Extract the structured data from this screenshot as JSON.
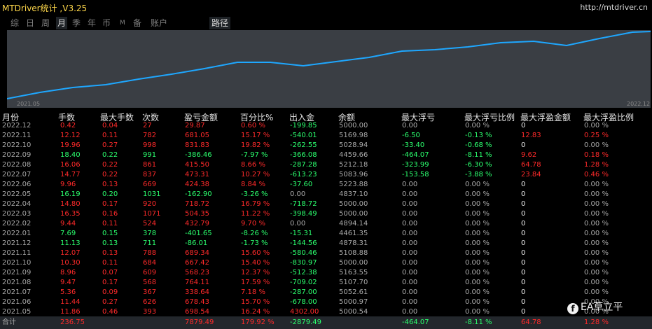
{
  "app": {
    "title": "MTDriver统计 ,V3.25",
    "url": "http://mtdriver.cn"
  },
  "tabs": [
    {
      "label": "综",
      "selected": false
    },
    {
      "label": "日",
      "selected": false
    },
    {
      "label": "周",
      "selected": false
    },
    {
      "label": "月",
      "selected": true
    },
    {
      "label": "季",
      "selected": false
    },
    {
      "label": "年",
      "selected": false
    },
    {
      "label": "币",
      "selected": false
    },
    {
      "label": "M",
      "selected": false
    },
    {
      "label": "备",
      "selected": false
    },
    {
      "label": "账户",
      "selected": false
    },
    {
      "label": "路径",
      "selected": true
    }
  ],
  "chart": {
    "start_label": "2021.05",
    "end_label": "2022.12",
    "line_color": "#1ea7ff",
    "background": "#3a3e44"
  },
  "colors": {
    "red": "#ff2a2a",
    "green": "#2bff6e",
    "white": "#e8e8e8",
    "gray": "#a8a8a8",
    "yellow": "#ffd84a"
  },
  "table": {
    "headers": [
      "月份",
      "手数",
      "最大手数",
      "次数",
      "盈亏金额",
      "百分比%",
      "出入金",
      "余额",
      "最大浮亏",
      "最大浮亏比例",
      "最大浮盈金额",
      "最大浮盈比例"
    ],
    "rows": [
      {
        "c": [
          "2022.12",
          "0.42",
          "0.04",
          "27",
          "29.87",
          "0.60 %",
          "-199.85",
          "5000.00",
          "0.00",
          "0.00 %",
          "0",
          "0.00 %"
        ],
        "t": [
          "gray",
          "red",
          "red",
          "red",
          "red",
          "red",
          "green",
          "gray",
          "gray",
          "gray",
          "white",
          "gray"
        ]
      },
      {
        "c": [
          "2022.11",
          "12.12",
          "0.11",
          "782",
          "681.05",
          "15.17 %",
          "-540.01",
          "5169.98",
          "-6.50",
          "-0.13 %",
          "12.83",
          "0.25 %"
        ],
        "t": [
          "gray",
          "red",
          "red",
          "red",
          "red",
          "red",
          "green",
          "gray",
          "green",
          "green",
          "red",
          "red"
        ]
      },
      {
        "c": [
          "2022.10",
          "19.96",
          "0.27",
          "998",
          "831.83",
          "19.82 %",
          "-262.55",
          "5028.94",
          "-33.40",
          "-0.68 %",
          "0",
          "0.00 %"
        ],
        "t": [
          "gray",
          "red",
          "red",
          "red",
          "red",
          "red",
          "green",
          "gray",
          "green",
          "green",
          "white",
          "gray"
        ]
      },
      {
        "c": [
          "2022.09",
          "18.40",
          "0.22",
          "991",
          "-386.46",
          "-7.97 %",
          "-366.08",
          "4459.66",
          "-464.07",
          "-8.11 %",
          "9.62",
          "0.18 %"
        ],
        "t": [
          "gray",
          "green",
          "green",
          "green",
          "green",
          "green",
          "green",
          "gray",
          "green",
          "green",
          "red",
          "red"
        ]
      },
      {
        "c": [
          "2022.08",
          "16.06",
          "0.22",
          "861",
          "415.50",
          "8.66 %",
          "-287.28",
          "5212.18",
          "-323.99",
          "-6.30 %",
          "64.78",
          "1.28 %"
        ],
        "t": [
          "gray",
          "red",
          "red",
          "red",
          "red",
          "red",
          "green",
          "gray",
          "green",
          "green",
          "red",
          "red"
        ]
      },
      {
        "c": [
          "2022.07",
          "14.77",
          "0.22",
          "837",
          "473.31",
          "10.27 %",
          "-613.23",
          "5083.96",
          "-153.58",
          "-3.88 %",
          "23.84",
          "0.46 %"
        ],
        "t": [
          "gray",
          "red",
          "red",
          "red",
          "red",
          "red",
          "green",
          "gray",
          "green",
          "green",
          "red",
          "red"
        ]
      },
      {
        "c": [
          "2022.06",
          "9.96",
          "0.13",
          "669",
          "424.38",
          "8.84 %",
          "-37.60",
          "5223.88",
          "0.00",
          "0.00 %",
          "0",
          "0.00 %"
        ],
        "t": [
          "gray",
          "red",
          "red",
          "red",
          "red",
          "red",
          "green",
          "gray",
          "gray",
          "gray",
          "white",
          "gray"
        ]
      },
      {
        "c": [
          "2022.05",
          "16.19",
          "0.20",
          "1031",
          "-162.90",
          "-3.26 %",
          "0.00",
          "4837.10",
          "0.00",
          "0.00 %",
          "0",
          "0.00 %"
        ],
        "t": [
          "gray",
          "green",
          "green",
          "green",
          "green",
          "green",
          "gray",
          "gray",
          "gray",
          "gray",
          "white",
          "gray"
        ]
      },
      {
        "c": [
          "2022.04",
          "14.80",
          "0.17",
          "920",
          "718.72",
          "16.79 %",
          "-718.72",
          "5000.00",
          "0.00",
          "0.00 %",
          "0",
          "0.00 %"
        ],
        "t": [
          "gray",
          "red",
          "red",
          "red",
          "red",
          "red",
          "green",
          "gray",
          "gray",
          "gray",
          "white",
          "gray"
        ]
      },
      {
        "c": [
          "2022.03",
          "16.35",
          "0.16",
          "1071",
          "504.35",
          "11.22 %",
          "-398.49",
          "5000.00",
          "0.00",
          "0.00 %",
          "0",
          "0.00 %"
        ],
        "t": [
          "gray",
          "red",
          "red",
          "red",
          "red",
          "red",
          "green",
          "gray",
          "gray",
          "gray",
          "white",
          "gray"
        ]
      },
      {
        "c": [
          "2022.02",
          "9.44",
          "0.11",
          "524",
          "432.79",
          "9.70 %",
          "0.00",
          "4894.14",
          "0.00",
          "0.00 %",
          "0",
          "0.00 %"
        ],
        "t": [
          "gray",
          "red",
          "red",
          "red",
          "red",
          "red",
          "gray",
          "gray",
          "gray",
          "gray",
          "white",
          "gray"
        ]
      },
      {
        "c": [
          "2022.01",
          "7.69",
          "0.15",
          "378",
          "-401.65",
          "-8.26 %",
          "-15.31",
          "4461.35",
          "0.00",
          "0.00 %",
          "0",
          "0.00 %"
        ],
        "t": [
          "gray",
          "green",
          "green",
          "green",
          "green",
          "green",
          "green",
          "gray",
          "gray",
          "gray",
          "white",
          "gray"
        ]
      },
      {
        "c": [
          "2021.12",
          "11.13",
          "0.13",
          "711",
          "-86.01",
          "-1.73 %",
          "-144.56",
          "4878.31",
          "0.00",
          "0.00 %",
          "0",
          "0.00 %"
        ],
        "t": [
          "gray",
          "green",
          "green",
          "green",
          "green",
          "green",
          "green",
          "gray",
          "gray",
          "gray",
          "white",
          "gray"
        ]
      },
      {
        "c": [
          "2021.11",
          "12.07",
          "0.13",
          "788",
          "689.34",
          "15.60 %",
          "-580.46",
          "5108.88",
          "0.00",
          "0.00 %",
          "0",
          "0.00 %"
        ],
        "t": [
          "gray",
          "red",
          "red",
          "red",
          "red",
          "red",
          "green",
          "gray",
          "gray",
          "gray",
          "white",
          "gray"
        ]
      },
      {
        "c": [
          "2021.10",
          "10.30",
          "0.11",
          "684",
          "667.42",
          "15.40 %",
          "-830.97",
          "5000.00",
          "0.00",
          "0.00 %",
          "0",
          "0.00 %"
        ],
        "t": [
          "gray",
          "red",
          "red",
          "red",
          "red",
          "red",
          "green",
          "gray",
          "gray",
          "gray",
          "white",
          "gray"
        ]
      },
      {
        "c": [
          "2021.09",
          "8.96",
          "0.07",
          "609",
          "568.23",
          "12.37 %",
          "-512.38",
          "5163.55",
          "0.00",
          "0.00 %",
          "0",
          "0.00 %"
        ],
        "t": [
          "gray",
          "red",
          "red",
          "red",
          "red",
          "red",
          "green",
          "gray",
          "gray",
          "gray",
          "white",
          "gray"
        ]
      },
      {
        "c": [
          "2021.08",
          "9.47",
          "0.17",
          "568",
          "764.11",
          "17.59 %",
          "-709.02",
          "5107.70",
          "0.00",
          "0.00 %",
          "0",
          "0.00 %"
        ],
        "t": [
          "gray",
          "red",
          "red",
          "red",
          "red",
          "red",
          "green",
          "gray",
          "gray",
          "gray",
          "white",
          "gray"
        ]
      },
      {
        "c": [
          "2021.07",
          "5.36",
          "0.09",
          "367",
          "338.64",
          "7.18 %",
          "-287.00",
          "5052.61",
          "0.00",
          "0.00 %",
          "0",
          "0.00 %"
        ],
        "t": [
          "gray",
          "red",
          "red",
          "red",
          "red",
          "red",
          "green",
          "gray",
          "gray",
          "gray",
          "white",
          "gray"
        ]
      },
      {
        "c": [
          "2021.06",
          "11.44",
          "0.27",
          "626",
          "678.43",
          "15.70 %",
          "-678.00",
          "5000.97",
          "0.00",
          "0.00 %",
          "0",
          "0.00 %"
        ],
        "t": [
          "gray",
          "red",
          "red",
          "red",
          "red",
          "red",
          "green",
          "gray",
          "gray",
          "gray",
          "white",
          "gray"
        ]
      },
      {
        "c": [
          "2021.05",
          "11.86",
          "0.46",
          "393",
          "698.54",
          "16.24 %",
          "4302.00",
          "5000.54",
          "0.00",
          "0.00 %",
          "0",
          "0.00 %"
        ],
        "t": [
          "gray",
          "red",
          "red",
          "red",
          "red",
          "red",
          "red",
          "gray",
          "gray",
          "gray",
          "white",
          "gray"
        ]
      }
    ],
    "total": {
      "c": [
        "合计",
        "236.75",
        "",
        "",
        "7879.49",
        "179.92 %",
        "-2879.49",
        "",
        "-464.07",
        "-8.11 %",
        "64.78",
        "1.28 %"
      ],
      "t": [
        "gray",
        "red",
        "gray",
        "gray",
        "red",
        "red",
        "green",
        "gray",
        "green",
        "green",
        "red",
        "red"
      ]
    }
  },
  "watermark": "EA草立平"
}
